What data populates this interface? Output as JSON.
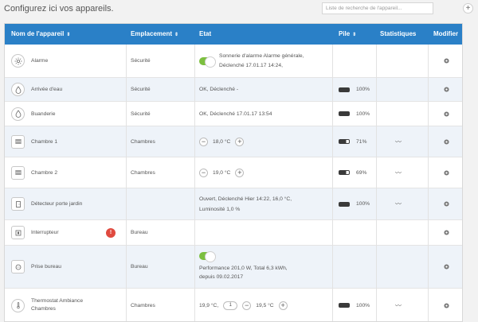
{
  "header": {
    "title": "Configurez ici vos appareils."
  },
  "search": {
    "placeholder": "Liste de recherche de l'appareil..."
  },
  "add_button": {
    "label": "+"
  },
  "table": {
    "columns": {
      "name": "Nom de l'appareil",
      "location": "Emplacement",
      "state": "Etat",
      "battery": "Pile",
      "stats": "Statistiques",
      "edit": "Modifier"
    },
    "sort_icon": "⇕",
    "rows": [
      {
        "name": "Alarme",
        "location": "Sécurité",
        "state_line1": "Sonnerie d'alarme Alarme générale,",
        "state_line2": "Déclenché 17.01.17 14:24,",
        "battery": "",
        "icon": "alarm-icon"
      },
      {
        "name": "Arrivée d'eau",
        "location": "Sécurité",
        "state": "OK,  Déclenché -",
        "battery": "100%",
        "icon": "water-drop-icon"
      },
      {
        "name": "Buanderie",
        "location": "Sécurité",
        "state": "OK,  Déclenché 17.01.17 13:54",
        "battery": "100%",
        "icon": "water-drop-icon"
      },
      {
        "name": "Chambre 1",
        "location": "Chambres",
        "temp": "18,0 °C",
        "battery": "71%",
        "icon": "radiator-icon"
      },
      {
        "name": "Chambre 2",
        "location": "Chambres",
        "temp": "19,0 °C",
        "battery": "69%",
        "icon": "radiator-icon"
      },
      {
        "name": "Détecteur porte jardin",
        "location": "",
        "state_line1": "Ouvert,  Déclenché Hier 14:22,  16,0 °C,",
        "state_line2": "Luminosité 1,0 %",
        "battery": "100%",
        "icon": "door-sensor-icon"
      },
      {
        "name": "Interrupteur",
        "location": "Bureau",
        "warning": "!",
        "icon": "switch-icon"
      },
      {
        "name": "Prise bureau",
        "location": "Bureau",
        "state_line1": "Performance 201,0 W,  Total 6,3 kWh,",
        "state_line2": "depuis 09.02.2017",
        "icon": "plug-icon"
      },
      {
        "name_line1": "Thermostat Ambiance",
        "name_line2": "Chambres",
        "location": "Chambres",
        "current_temp": "19,9 °C,",
        "dial_value": "1",
        "temp": "19,5 °C",
        "battery": "100%",
        "icon": "thermostat-icon"
      }
    ]
  },
  "colors": {
    "header_blue": "#2a80c7",
    "toggle_green": "#7cbf3f",
    "warning_red": "#e04a3f"
  }
}
